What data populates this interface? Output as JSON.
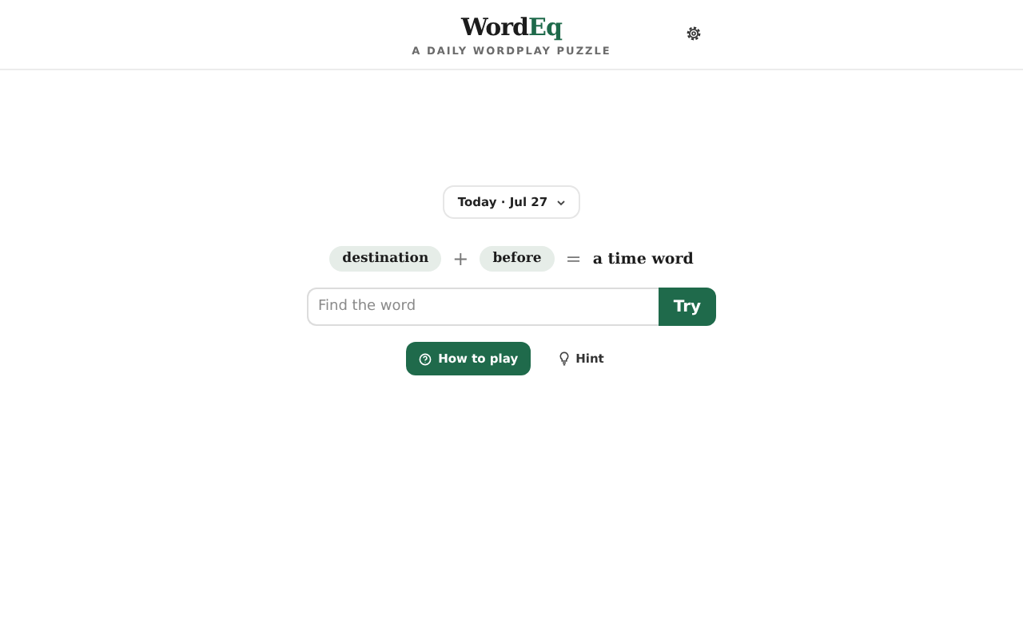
{
  "header": {
    "logo_main": "Word",
    "logo_accent": "Eq",
    "tagline": "A DAILY WORDPLAY PUZZLE"
  },
  "date_picker": {
    "label": "Today · Jul 27"
  },
  "equation": [
    {
      "kind": "term",
      "text": "destination"
    },
    {
      "kind": "operator",
      "text": "+"
    },
    {
      "kind": "term",
      "text": "before"
    },
    {
      "kind": "operator",
      "text": "="
    },
    {
      "kind": "answer",
      "text": "a time word"
    }
  ],
  "guess": {
    "placeholder": "Find the word",
    "button": "Try"
  },
  "actions": [
    {
      "kind": "primary",
      "label": "How to play"
    },
    {
      "kind": "plain",
      "label": "Hint"
    }
  ]
}
